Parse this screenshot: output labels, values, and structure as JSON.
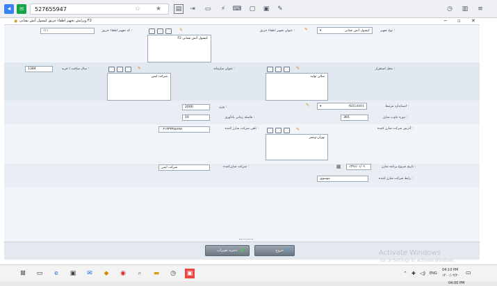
{
  "browser": {
    "address": "527655947"
  },
  "window": {
    "title": "ویرایش تجهیز اطفاء حریق کپسول آتش نشانی F2"
  },
  "form": {
    "equipment_type_label": "نوع تجهیز :",
    "equipment_type_value": "کپسول آتش نشانی",
    "equipment_title_label": "عنوان تجهیز اطفاء حریق :",
    "equipment_title_value": "کپسول آتش نشانی F2",
    "code_label": "کد تجهیز اطفاء حریق :",
    "code_value": "۱۱۱",
    "location_label": "محل استقرار :",
    "location_value": "سالن تولید",
    "organization_label": "عنوان سازمانه :",
    "organization_value": "شرکت ایمن",
    "build_year_label": "سال ساخت / خرید :",
    "build_year_value": "1384",
    "standard_label": "استاندارد مرتبط :",
    "standard_value": "ISO14001",
    "weight_label": "وزن :",
    "weight_value": "2000",
    "inspection_period_label": "دوره تناوب شارژ :",
    "inspection_period_value": "365",
    "reminder_label": "فاصله زمانی یادآوری :",
    "reminder_value": "10",
    "charger_address_label": "آدرس شرکت شارژ کننده :",
    "charger_address_value": "تهران-ونصر",
    "charger_phone_label": "تلفن شرکت شارژ کننده :",
    "charger_phone_value": "۰۲۱۳۳۳۳۵۸۶۷۸۰",
    "charge_start_label": "تاریخ شروع برنامه شارژ :",
    "charge_start_value": "۱۳۹۶/۰۱/۰۹",
    "charger_company_label": "شرکت شارژکننده :",
    "charger_company_value": "شرکت ایمن",
    "charger_contact_label": "رابط شرکت شارژ کننده :",
    "charger_contact_value": "موسوی"
  },
  "buttons": {
    "save_label": "ذخیره تغییرات",
    "exit_label": "خروج"
  },
  "watermark": {
    "line1": "Activate Windows",
    "line2": "Go to Settings to activate Windows."
  },
  "taskbar": {
    "time": "04:10 PM",
    "date": "۱۴۰۰/۰۲/۲۰",
    "lang": "ENG",
    "time2": "04:00 PM"
  }
}
